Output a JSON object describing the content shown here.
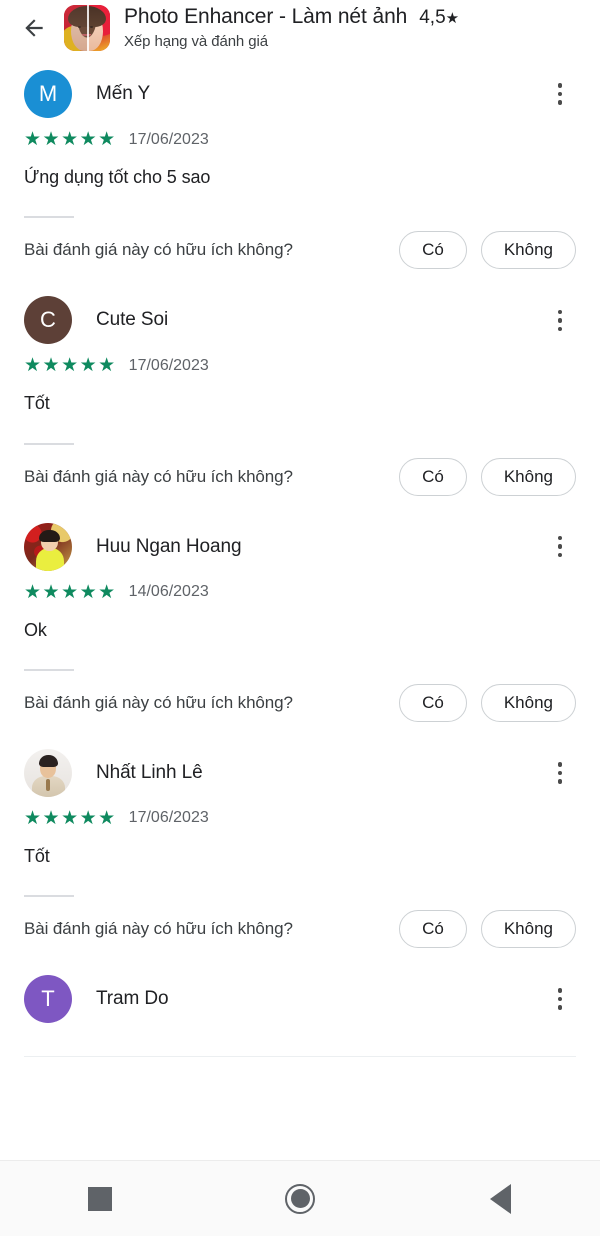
{
  "header": {
    "back_icon": "back-arrow-icon",
    "app_icon": "app-icon-photo-enhancer",
    "title": "Photo Enhancer - Làm nét ảnh",
    "rating": "4,5",
    "rating_star": "★",
    "subtitle": "Xếp hạng và đánh giá"
  },
  "reviews": [
    {
      "avatar_type": "letter",
      "avatar_letter": "M",
      "avatar_color": "#1a8fd4",
      "name": "Mến Y",
      "stars": "★★★★★",
      "star_count": 5,
      "date": "17/06/2023",
      "text": "Ứng dụng tốt cho 5 sao",
      "helpful_label": "Bài đánh giá này có hữu ích không?",
      "yes_label": "Có",
      "no_label": "Không"
    },
    {
      "avatar_type": "letter",
      "avatar_letter": "C",
      "avatar_color": "#5d4037",
      "name": "Cute Soi",
      "stars": "★★★★★",
      "star_count": 5,
      "date": "17/06/2023",
      "text": "Tốt",
      "helpful_label": "Bài đánh giá này có hữu ích không?",
      "yes_label": "Có",
      "no_label": "Không"
    },
    {
      "avatar_type": "photo",
      "avatar_letter": "",
      "avatar_color": "#a61616",
      "name": "Huu Ngan Hoang",
      "stars": "★★★★★",
      "star_count": 5,
      "date": "14/06/2023",
      "text": "Ok",
      "helpful_label": "Bài đánh giá này có hữu ích không?",
      "yes_label": "Có",
      "no_label": "Không"
    },
    {
      "avatar_type": "photo",
      "avatar_letter": "",
      "avatar_color": "#e7e3df",
      "name": "Nhất Linh Lê",
      "stars": "★★★★★",
      "star_count": 5,
      "date": "17/06/2023",
      "text": "Tốt",
      "helpful_label": "Bài đánh giá này có hữu ích không?",
      "yes_label": "Có",
      "no_label": "Không"
    },
    {
      "avatar_type": "letter",
      "avatar_letter": "T",
      "avatar_color": "#7e57c2",
      "name": "Tram Do",
      "stars": "",
      "star_count": 0,
      "date": "",
      "text": "",
      "helpful_label": "",
      "yes_label": "",
      "no_label": ""
    }
  ],
  "colors": {
    "star_green": "#0f8a5f",
    "text_primary": "#202124",
    "text_secondary": "#5f6368",
    "divider": "#dadce0",
    "nav_icon": "#5f6368"
  },
  "navbar": {
    "recents_icon": "square-recents-icon",
    "home_icon": "circle-home-icon",
    "back_icon": "triangle-back-icon"
  }
}
